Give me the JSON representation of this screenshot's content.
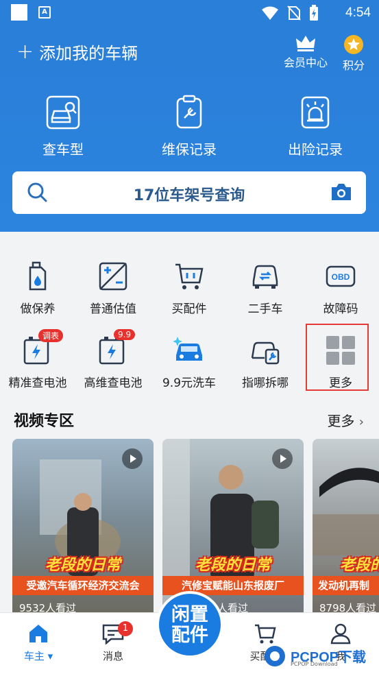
{
  "status": {
    "time": "4:54",
    "a_icon": "A"
  },
  "header": {
    "add_car": "添加我的车辆",
    "member_label": "会员中心",
    "points_label": "积分",
    "quick": [
      {
        "label": "查车型",
        "icon": "car-search-icon"
      },
      {
        "label": "维保记录",
        "icon": "maintenance-clipboard-icon"
      },
      {
        "label": "出险记录",
        "icon": "accident-siren-icon"
      }
    ],
    "search_text": "17位车架号查询"
  },
  "grid": {
    "row1": [
      {
        "label": "做保养",
        "icon": "oil-can-icon"
      },
      {
        "label": "普通估值",
        "icon": "valuation-icon"
      },
      {
        "label": "买配件",
        "icon": "cart-icon"
      },
      {
        "label": "二手车",
        "icon": "used-car-icon"
      },
      {
        "label": "故障码",
        "icon": "obd-icon",
        "icon_text": "OBD"
      }
    ],
    "row2": [
      {
        "label": "精准查电池",
        "icon": "battery-icon",
        "badge": "调表"
      },
      {
        "label": "高维查电池",
        "icon": "battery-icon",
        "badge": "9.9"
      },
      {
        "label": "9.9元洗车",
        "icon": "car-wash-icon"
      },
      {
        "label": "指哪拆哪",
        "icon": "car-tool-icon"
      },
      {
        "label": "更多",
        "icon": "more-grid-icon"
      }
    ]
  },
  "videos": {
    "title": "视频专区",
    "more": "更多",
    "cards": [
      {
        "title": "老段的日常",
        "subtitle": "受邀汽车循环经济交流会",
        "views": "9532人看过"
      },
      {
        "title": "老段的日常",
        "subtitle": "汽修宝赋能山东报废厂",
        "views": "人看过"
      },
      {
        "title": "老段的日常",
        "subtitle": "发动机再制",
        "views": "8798人看过"
      }
    ]
  },
  "nav": {
    "home": "车主",
    "messages": "消息",
    "messages_badge": "1",
    "center_line1": "闲置",
    "center_line2": "配件",
    "buy": "买配件",
    "me": "我"
  },
  "watermark": {
    "text": "PCPOP下载",
    "sub": "PCPOP Download"
  },
  "colors": {
    "primary": "#2a7fd8",
    "badge": "#e8302c",
    "accent": "#1a7be0"
  }
}
